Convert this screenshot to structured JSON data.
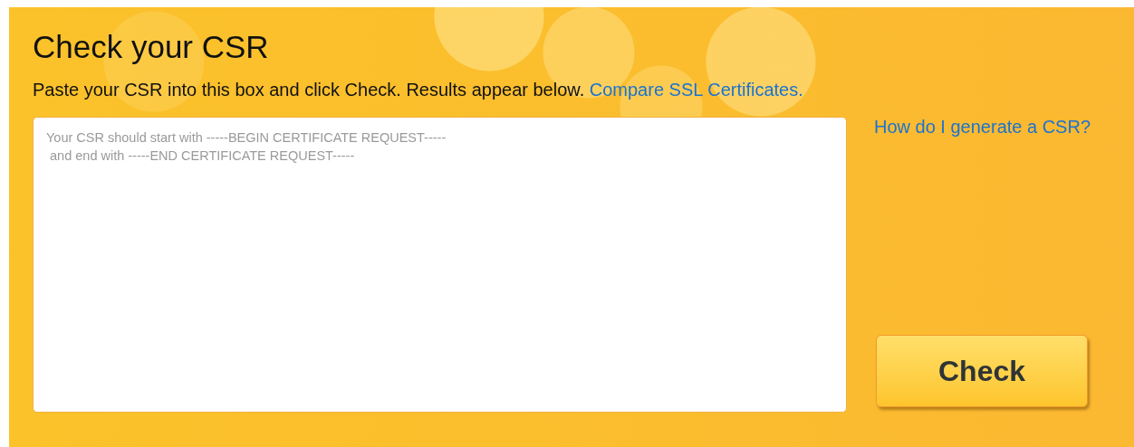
{
  "title": "Check your CSR",
  "intro": {
    "text": "Paste your CSR into this box and click Check. Results appear below.",
    "link": "Compare SSL Certificates."
  },
  "csr_field": {
    "placeholder": "Your CSR should start with -----BEGIN CERTIFICATE REQUEST-----\n and end with -----END CERTIFICATE REQUEST-----"
  },
  "help_link": "How do I generate a CSR?",
  "button": "Check"
}
